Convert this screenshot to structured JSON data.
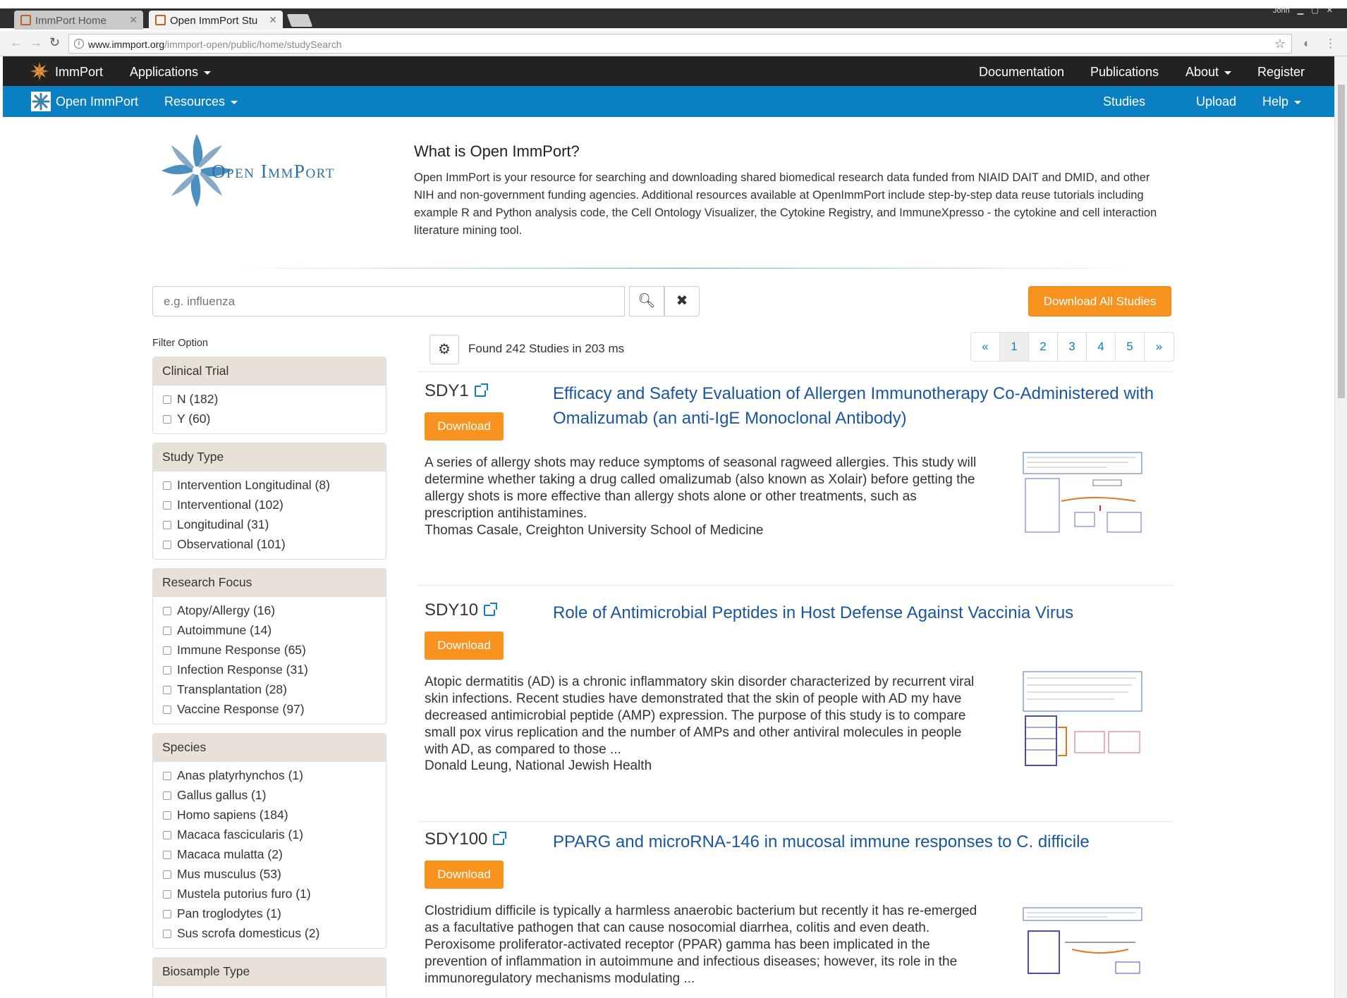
{
  "browser": {
    "tabs": [
      {
        "label": "ImmPort Home"
      },
      {
        "label": "Open ImmPort Stu"
      }
    ],
    "user": "John",
    "url_host": "www.immport.org",
    "url_path": "/immport-open/public/home/studySearch"
  },
  "nav_primary": {
    "brand": "ImmPort",
    "applications": "Applications",
    "documentation": "Documentation",
    "publications": "Publications",
    "about": "About",
    "register": "Register"
  },
  "nav_secondary": {
    "brand": "Open ImmPort",
    "resources": "Resources",
    "studies": "Studies",
    "upload": "Upload",
    "help": "Help"
  },
  "header": {
    "logo_text": "Open ImmPort",
    "title": "What is Open ImmPort?",
    "text": "Open ImmPort is your resource for searching and downloading shared biomedical research data funded from NIAID DAIT and DMID, and other NIH and non-government funding agencies. Additional resources available at OpenImmPort include step-by-step data reuse tutorials including example R and Python analysis code, the Cell Ontology Visualizer, the Cytokine Registry, and ImmuneXpresso - the cytokine and cell interaction literature mining tool."
  },
  "search": {
    "placeholder": "e.g. influenza",
    "download_all": "Download All Studies"
  },
  "filters": {
    "label": "Filter Option",
    "groups": [
      {
        "title": "Clinical Trial",
        "options": [
          "N (182)",
          "Y (60)"
        ]
      },
      {
        "title": "Study Type",
        "options": [
          "Intervention Longitudinal (8)",
          "Interventional (102)",
          "Longitudinal (31)",
          "Observational (101)"
        ]
      },
      {
        "title": "Research Focus",
        "options": [
          "Atopy/Allergy (16)",
          "Autoimmune (14)",
          "Immune Response (65)",
          "Infection Response (31)",
          "Transplantation (28)",
          "Vaccine Response (97)"
        ]
      },
      {
        "title": "Species",
        "options": [
          "Anas platyrhynchos (1)",
          "Gallus gallus (1)",
          "Homo sapiens (184)",
          "Macaca fascicularis (1)",
          "Macaca mulatta (2)",
          "Mus musculus (53)",
          "Mustela putorius furo (1)",
          "Pan troglodytes (1)",
          "Sus scrofa domesticus (2)"
        ]
      },
      {
        "title": "Biosample Type",
        "options": []
      }
    ]
  },
  "results": {
    "found": "Found 242 Studies in 203 ms",
    "pages": [
      "«",
      "1",
      "2",
      "3",
      "4",
      "5",
      "»"
    ],
    "current_page": "1",
    "download_label": "Download",
    "studies": [
      {
        "id": "SDY1",
        "title": "Efficacy and Safety Evaluation of Allergen Immunotherapy Co-Administered with Omalizumab (an anti-IgE Monoclonal Antibody)",
        "description": "A series of allergy shots may reduce symptoms of seasonal ragweed allergies. This study will determine whether taking a drug called omalizumab (also known as Xolair) before getting the allergy shots is more effective than allergy shots alone or other treatments, such as prescription antihistamines.",
        "pi": "Thomas Casale, Creighton University School of Medicine"
      },
      {
        "id": "SDY10",
        "title": "Role of Antimicrobial Peptides in Host Defense Against Vaccinia Virus",
        "description": "Atopic dermatitis (AD) is a chronic inflammatory skin disorder characterized by recurrent viral skin infections. Recent studies have demonstrated that the skin of people with AD my have decreased antimicrobial peptide (AMP) expression. The purpose of this study is to compare small pox virus replication and the number of AMPs and other antiviral molecules in people with AD, as compared to those ...",
        "pi": "Donald Leung, National Jewish Health"
      },
      {
        "id": "SDY100",
        "title": "PPARG and microRNA-146 in mucosal immune responses to C. difficile",
        "description": "Clostridium difficile is typically a harmless anaerobic bacterium but recently it has re-emerged as a facultative pathogen that can cause nosocomial diarrhea, colitis and even death. Peroxisome proliferator-activated receptor (PPAR) gamma has been implicated in the prevention of inflammation in autoimmune and infectious diseases; however, its role in the immunoregulatory mechanisms modulating ...",
        "pi": ""
      }
    ]
  },
  "colors": {
    "nav_dark": "#222222",
    "nav_blue": "#0a80c3",
    "accent_orange": "#f7931e",
    "link_blue": "#1a56a0",
    "filter_header": "#e8e1d8"
  }
}
